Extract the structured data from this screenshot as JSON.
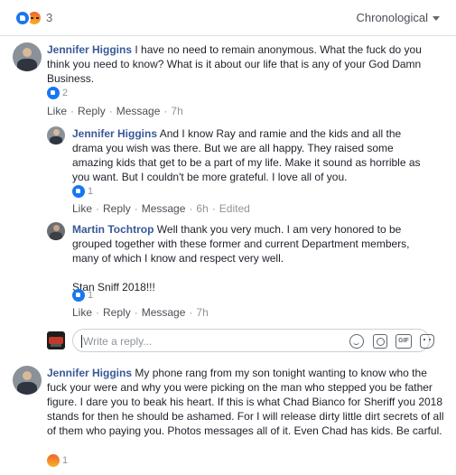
{
  "header": {
    "reaction_count": "3",
    "sort_label": "Chronological"
  },
  "comments": [
    {
      "author": "Jennifer Higgins",
      "body": "I have no need to remain anonymous. What the fuck do you think you need to know? What is it about our life that is any of your God Damn Business.",
      "reaction_type": "like",
      "reaction_count": "2",
      "like_label": "Like",
      "reply_label": "Reply",
      "message_label": "Message",
      "time": "7h"
    },
    {
      "author": "Jennifer Higgins",
      "body": "And I know Ray and ramie and the kids and all the drama you wish was there. But we are all happy. They raised some amazing kids that get to be a part of my life. Make it sound as horrible as you want. But I couldn't be more grateful. I love all of you.",
      "reaction_type": "like",
      "reaction_count": "1",
      "like_label": "Like",
      "reply_label": "Reply",
      "message_label": "Message",
      "time": "6h",
      "edited_label": "Edited"
    },
    {
      "author": "Martin Tochtrop",
      "body": "Well thank you very much. I am very honored to be grouped together with these former and current Department members, many of which I know and respect very well.",
      "extra": "Stan Sniff 2018!!!",
      "reaction_type": "like",
      "reaction_count": "1",
      "like_label": "Like",
      "reply_label": "Reply",
      "message_label": "Message",
      "time": "7h"
    },
    {
      "author": "Jennifer Higgins",
      "body": "My phone rang from my son tonight wanting to know who the fuck your were and why you were picking on the man who stepped you be father figure. I dare you to beak his heart. If this is what Chad Bianco for Sheriff you 2018 stands for then he should be ashamed. For I will release dirty little dirt secrets of all of them who paying you. Photos messages all of it. Even Chad has kids. Be carful.",
      "reaction_type": "angry",
      "reaction_count": "1"
    }
  ],
  "reply_box": {
    "placeholder": "Write a reply...",
    "gif_label": "GIF"
  },
  "colors": {
    "name": "#385898",
    "like": "#1877f2",
    "meta": "#90949c"
  }
}
